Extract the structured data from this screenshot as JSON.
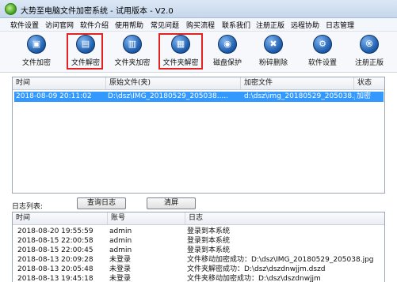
{
  "window": {
    "title": "大势至电脑文件加密系统 - 试用版本 - V2.0"
  },
  "menu": [
    "软件设置",
    "访问官网",
    "软件介绍",
    "使用帮助",
    "常见问题",
    "购买流程",
    "联系我们",
    "注册正版",
    "远程协助",
    "日志管理"
  ],
  "toolbar": [
    {
      "label": "文件加密",
      "icon": "file-lock-icon",
      "glyph": "▣"
    },
    {
      "label": "文件解密",
      "icon": "file-unlock-icon",
      "glyph": "▤"
    },
    {
      "label": "文件夹加密",
      "icon": "folder-lock-icon",
      "glyph": "▥"
    },
    {
      "label": "文件夹解密",
      "icon": "folder-unlock-icon",
      "glyph": "▦"
    },
    {
      "label": "磁盘保护",
      "icon": "disk-protect-icon",
      "glyph": "◉"
    },
    {
      "label": "粉碎删除",
      "icon": "shred-icon",
      "glyph": "✖"
    },
    {
      "label": "软件设置",
      "icon": "gear-icon",
      "glyph": "⚙"
    },
    {
      "label": "注册正版",
      "icon": "registered-icon",
      "glyph": "®"
    }
  ],
  "file_table": {
    "columns": [
      "时间",
      "原始文件(夹)",
      "加密文件",
      "状态"
    ],
    "rows": [
      [
        "2018-08-09 20:11:02",
        "D:\\dsz\\IMG_20180529_205038.....",
        "d:\\dsz\\img_20180529_205038.j...",
        "加密"
      ]
    ]
  },
  "log": {
    "label": "日志列表:",
    "query_button": "查询日志",
    "clear_button": "清屏",
    "columns": [
      "时间",
      "账号",
      "日志"
    ],
    "rows": [
      [
        "2018-08-20 19:55:59",
        "admin",
        "登录到本系统"
      ],
      [
        "2018-08-15 22:00:58",
        "admin",
        "登录到本系统"
      ],
      [
        "2018-08-15 22:00:45",
        "admin",
        "登录到本系统"
      ],
      [
        "2018-08-13 20:09:28",
        "未登录",
        "文件移动加密成功：D:\\dsz\\IMG_20180529_205038.jpg"
      ],
      [
        "2018-08-13 20:05:48",
        "未登录",
        "文件夹解密成功：D:\\dsz\\dszdnwjjm.dszd"
      ],
      [
        "2018-08-13 19:45:18",
        "未登录",
        "文件夹移动加密成功：D:\\dsz\\dszdnwjjm"
      ]
    ]
  }
}
